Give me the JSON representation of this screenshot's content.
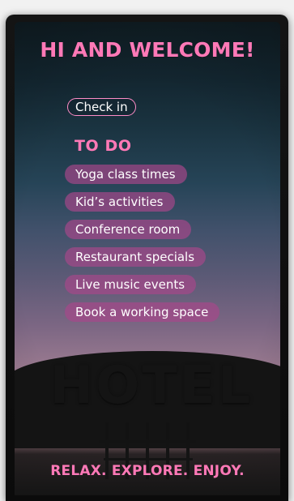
{
  "screen": {
    "title": "HI AND WELCOME!",
    "check_in_label": "Check in",
    "todo": {
      "title": "TO DO",
      "items": [
        "Yoga class times",
        "Kid’s activities",
        "Conference room",
        "Restaurant specials",
        "Live music events",
        "Book a working space"
      ]
    },
    "sign_text": "HOTEL",
    "footer": "RELAX. EXPLORE. ENJOY."
  },
  "colors": {
    "accent_pink": "#ff79b7",
    "pill_fill": "#a8478b",
    "pill_border": "#ff8cc7"
  }
}
